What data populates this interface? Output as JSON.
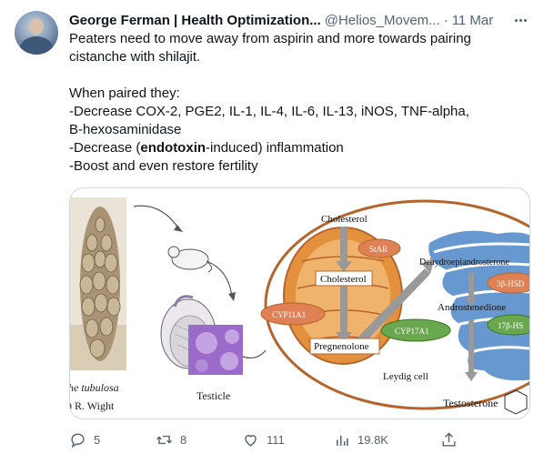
{
  "author": {
    "name": "George Ferman | Health Optimization...",
    "handle": "@Helios_Movem...",
    "separator": "·",
    "date": "11 Mar"
  },
  "tweet": {
    "lines": [
      "Peaters need to move away from aspirin and more towards pairing",
      "cistanche with shilajit.",
      "",
      "When paired they:",
      "-Decrease COX-2, PGE2, IL-1, IL-4, IL-6, IL-13, iNOS, TNF-alpha,",
      "B-hexosaminidase"
    ],
    "line7_prefix": "-Decrease (",
    "line7_bold": "endotoxin",
    "line7_suffix": "-induced) inflammation",
    "line8": "-Boost and even restore fertility"
  },
  "media": {
    "caption_species": "he tubulosa",
    "caption_author": ") R. Wight",
    "testicle_label": "Testicle",
    "cholesterol_top": "Cholesterol",
    "star": "StAR",
    "cholesterol_mid": "Cholesterol",
    "cyp11a1": "CYP11A1",
    "pregnenolone": "Pregnenolone",
    "cyp17a1": "CYP17A1",
    "dhea": "Dehydroepiandrosterone",
    "hsd3b": "3β-HSD",
    "androstenedione": "Androstenedione",
    "hsd17b": "17β-HS",
    "leydig": "Leydig cell",
    "testosterone": "Testosterone"
  },
  "actions": {
    "replies": "5",
    "retweets": "8",
    "likes": "111",
    "views": "19.8K"
  },
  "colors": {
    "text": "#0f1419",
    "muted": "#536471",
    "border": "#cfd9de",
    "cell_border": "#b5652c",
    "mito": "#e4913e",
    "enzyme_orange": "#e08155",
    "enzyme_green": "#6aa84f",
    "er_blue": "#4e86c8"
  }
}
